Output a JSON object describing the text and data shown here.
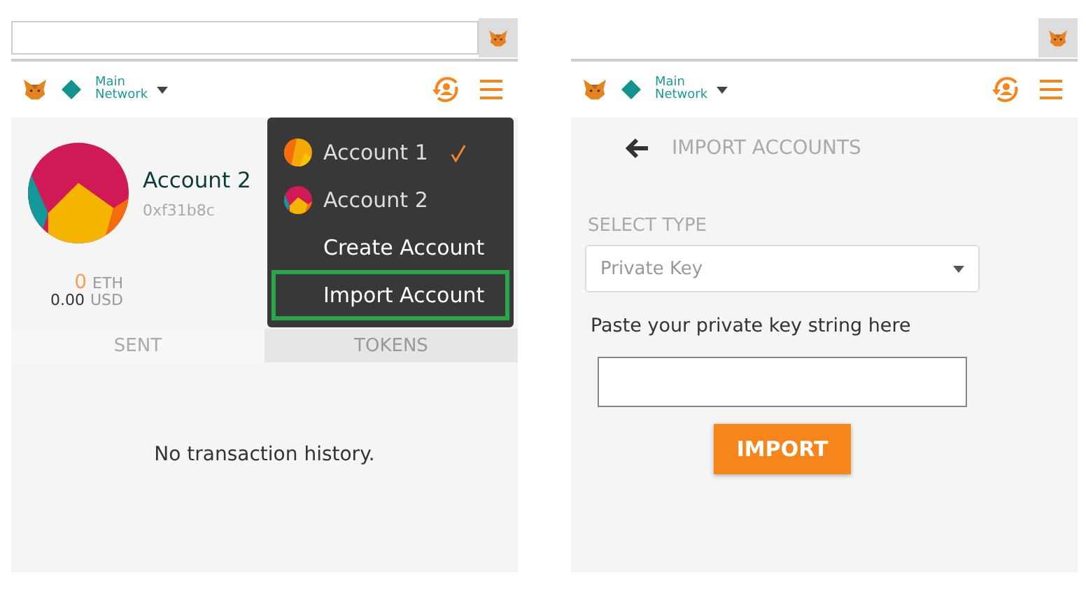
{
  "left_screen": {
    "header": {
      "network": [
        "Main",
        "Network"
      ]
    },
    "account": {
      "name": "Account 2",
      "address": "0xf31b8c",
      "balance": {
        "eth_amount": "0",
        "eth_unit": "ETH",
        "usd_amount": "0.00",
        "usd_unit": "USD"
      }
    },
    "tabs": [
      {
        "label": "SENT",
        "selected": true
      },
      {
        "label": "TOKENS",
        "selected": false
      }
    ],
    "empty_message": "No transaction history.",
    "account_menu": {
      "items": [
        {
          "kind": "account",
          "label": "Account 1",
          "checked": true,
          "highlighted": false
        },
        {
          "kind": "account",
          "label": "Account 2",
          "checked": false,
          "highlighted": false
        },
        {
          "kind": "action",
          "label": "Create Account",
          "checked": false,
          "highlighted": false
        },
        {
          "kind": "action",
          "label": "Import Account",
          "checked": false,
          "highlighted": true
        }
      ]
    }
  },
  "right_screen": {
    "header": {
      "network": [
        "Main",
        "Network"
      ]
    },
    "page_title": "IMPORT ACCOUNTS",
    "select_label": "SELECT TYPE",
    "select": {
      "value": "Private Key"
    },
    "field_label": "Paste your private key string here",
    "import_button": "IMPORT"
  }
}
